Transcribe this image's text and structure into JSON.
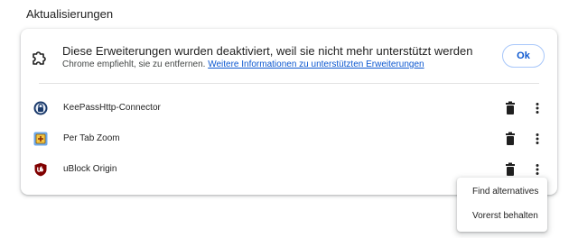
{
  "section": {
    "title": "Aktualisierungen"
  },
  "notice": {
    "icon": "puzzle-piece-icon",
    "title": "Diese Erweiterungen wurden deaktiviert, weil sie nicht mehr unterstützt werden",
    "subtitle": "Chrome empfiehlt, sie zu entfernen.",
    "link": "Weitere Informationen zu unterstützten Erweiterungen",
    "ok_label": "Ok"
  },
  "extensions": [
    {
      "name": "KeePassHttp-Connector",
      "icon": "keepass-icon"
    },
    {
      "name": "Per Tab Zoom",
      "icon": "per-tab-zoom-icon"
    },
    {
      "name": "uBlock Origin",
      "icon": "ublock-origin-icon"
    }
  ],
  "menu": {
    "items": [
      "Find alternatives",
      "Vorerst behalten"
    ]
  },
  "colors": {
    "link": "#0b57d0",
    "ok_border": "#a8c7fa",
    "ublock_red": "#800000"
  }
}
